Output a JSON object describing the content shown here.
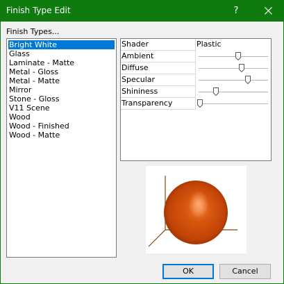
{
  "window": {
    "title": "Finish Type Edit",
    "help_glyph": "?"
  },
  "list_label": "Finish Types...",
  "finish_types": [
    "Bright White",
    "Glass",
    "Laminate - Matte",
    "Metal - Gloss",
    "Metal - Matte",
    "Mirror",
    "Stone - Gloss",
    "V11 Scene",
    "Wood",
    "Wood - Finished",
    "Wood - Matte"
  ],
  "selected_finish": "Bright White",
  "properties": {
    "shader": {
      "label": "Shader",
      "value": "Plastic"
    },
    "sliders": [
      {
        "label": "Ambient",
        "level": 0.57
      },
      {
        "label": "Diffuse",
        "level": 0.62
      },
      {
        "label": "Specular",
        "level": 0.71
      },
      {
        "label": "Shininess",
        "level": 0.25
      },
      {
        "label": "Transparency",
        "level": 0.02
      }
    ]
  },
  "preview": {
    "sphere_color": "#d4520a",
    "frame_color": "#7a4a12"
  },
  "buttons": {
    "ok": "OK",
    "cancel": "Cancel"
  },
  "colors": {
    "titlebar": "#0f7b0f",
    "selection": "#0078d7"
  }
}
